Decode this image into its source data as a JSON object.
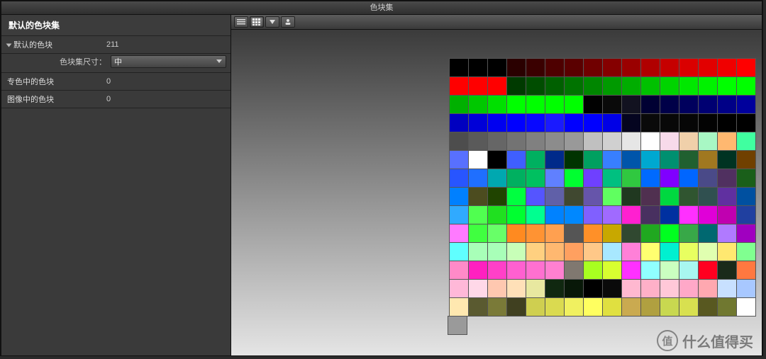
{
  "window": {
    "title": "色块集"
  },
  "sidebar": {
    "header": "默认的色块集",
    "rows": [
      {
        "label": "默认的色块",
        "value": "211",
        "expandable": true
      },
      {
        "size_label": "色块集尺寸：",
        "size_value": "中"
      },
      {
        "label": "专色中的色块",
        "value": "0"
      },
      {
        "label": "图像中的色块",
        "value": "0"
      }
    ]
  },
  "toolbar": {
    "buttons": [
      "list-view",
      "grid-view",
      "sort-view",
      "user-view"
    ],
    "active": "grid-view"
  },
  "swatches": {
    "cols": 16
  },
  "watermark": {
    "text": "什么值得买",
    "coin": "值"
  }
}
